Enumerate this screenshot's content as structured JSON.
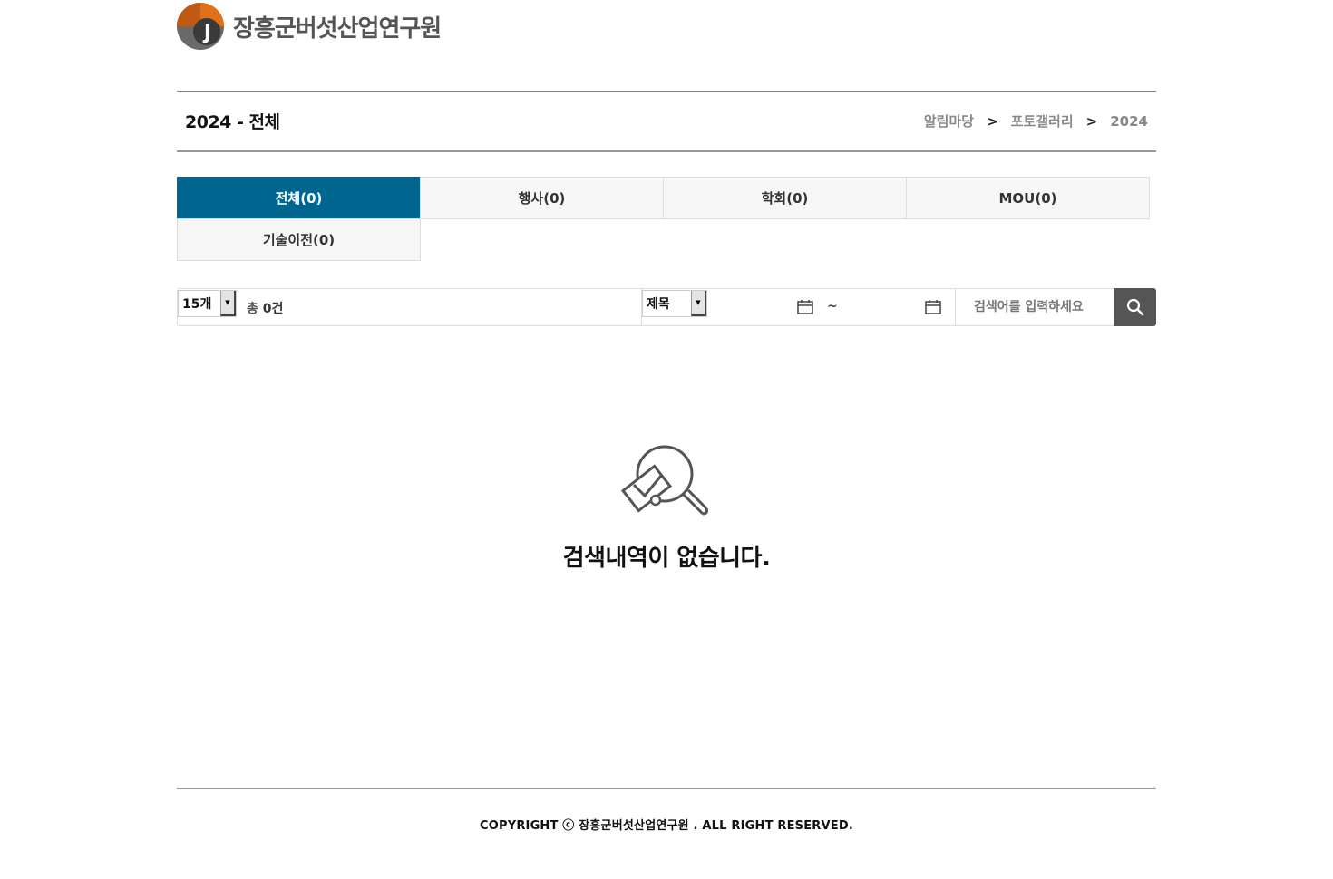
{
  "header": {
    "logo_letter": "J",
    "logo_text": "장흥군버섯산업연구원",
    "colors": {
      "logo_orange": "#e0701a",
      "logo_dark": "#3a3a3a"
    }
  },
  "title_bar": {
    "title": "2024 - 전체",
    "breadcrumb": [
      "알림마당",
      "포토갤러리",
      "2024"
    ],
    "separator": ">"
  },
  "tabs": [
    {
      "label": "전체(0)",
      "active": true
    },
    {
      "label": "행사(0)",
      "active": false
    },
    {
      "label": "학회(0)",
      "active": false
    },
    {
      "label": "MOU(0)",
      "active": false
    },
    {
      "label": "기술이전(0)",
      "active": false
    }
  ],
  "search": {
    "page_size": "15개",
    "total_label": "총",
    "total_count": "0건",
    "field": "제목",
    "range_separator": "~",
    "placeholder": "검색어를 입력하세요"
  },
  "empty_state": {
    "message": "검색내역이 없습니다."
  },
  "footer": {
    "copyright": "COPYRIGHT ⓒ 장흥군버섯산업연구원 . ALL RIGHT RESERVED."
  },
  "colors": {
    "active_tab": "#006690",
    "search_button": "#555555"
  },
  "icons": [
    "logo-icon",
    "calendar-icon",
    "search-icon",
    "no-results-icon"
  ]
}
